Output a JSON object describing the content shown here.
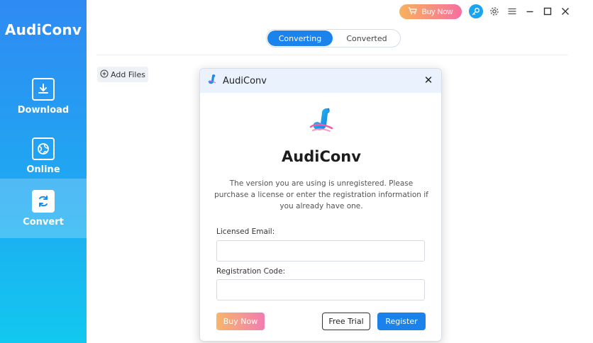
{
  "app": {
    "title": "AudiConv"
  },
  "sidebar": {
    "items": [
      {
        "label": "Download",
        "icon": "download-icon",
        "active": false
      },
      {
        "label": "Online",
        "icon": "globe-icon",
        "active": false
      },
      {
        "label": "Convert",
        "icon": "convert-icon",
        "active": true
      }
    ]
  },
  "titlebar": {
    "buy_now_label": "Buy Now",
    "icons": [
      "cart-icon",
      "key-icon",
      "gear-icon",
      "menu-icon",
      "minimize-icon",
      "maximize-icon",
      "close-icon"
    ]
  },
  "tabs": [
    {
      "label": "Converting",
      "active": true
    },
    {
      "label": "Converted",
      "active": false
    }
  ],
  "toolbar": {
    "add_files_label": "Add Files"
  },
  "dialog": {
    "title": "AudiConv",
    "app_name": "AudiConv",
    "message": "The version you are using is unregistered. Please purchase a license or enter the registration information if you already have one.",
    "email_label": "Licensed Email:",
    "email_value": "",
    "code_label": "Registration Code:",
    "code_value": "",
    "buy_now_label": "Buy Now",
    "free_trial_label": "Free Trial",
    "register_label": "Register"
  },
  "colors": {
    "accent": "#1b82ec",
    "sidebar_top": "#2f8af3",
    "sidebar_bottom": "#12c8f0",
    "buy_gradient_start": "#f8b56a",
    "buy_gradient_end": "#f27db1"
  }
}
